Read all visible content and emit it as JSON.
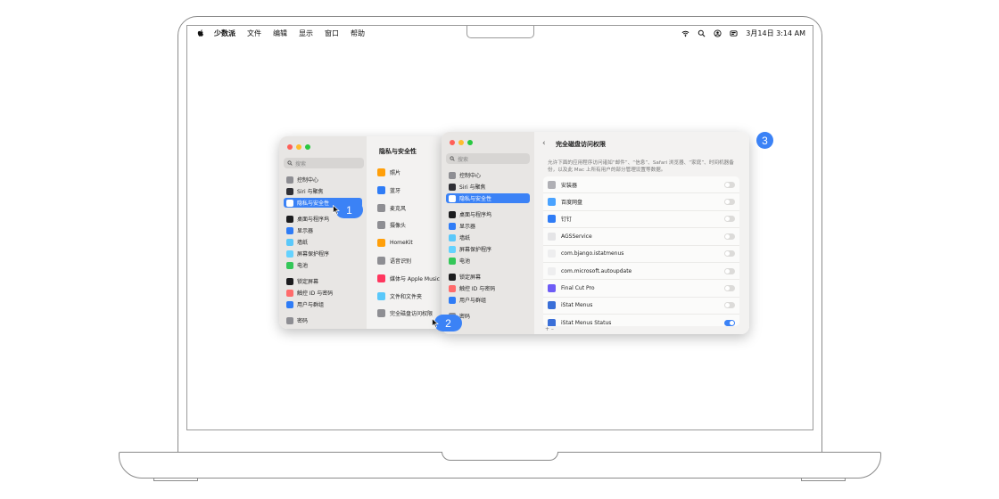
{
  "menubar": {
    "app_name": "少数派",
    "menus": [
      "文件",
      "编辑",
      "显示",
      "窗口",
      "帮助"
    ],
    "datetime": "3月14日  3:14 AM",
    "status_icons": [
      "wifi-icon",
      "search-icon",
      "user-icon",
      "control-center-icon"
    ]
  },
  "window1": {
    "search_placeholder": "搜索",
    "sidebar_items": [
      {
        "label": "控制中心",
        "color": "#8e8e93"
      },
      {
        "label": "Siri 与聚焦",
        "color": "#2f2f35"
      },
      {
        "label": "隐私与安全性",
        "color": "#3b82f6",
        "selected": true
      },
      {
        "label": "桌面与程序坞",
        "color": "#1c1c1e"
      },
      {
        "label": "显示器",
        "color": "#2f7cf6"
      },
      {
        "label": "墙纸",
        "color": "#5ac8fa"
      },
      {
        "label": "屏幕保护程序",
        "color": "#64d2ff"
      },
      {
        "label": "电池",
        "color": "#34c759"
      },
      {
        "label": "锁定屏幕",
        "color": "#1c1c1e"
      },
      {
        "label": "触控 ID 与密码",
        "color": "#ff6b6b"
      },
      {
        "label": "用户与群组",
        "color": "#2f7cf6"
      },
      {
        "label": "密码",
        "color": "#8e8e93"
      }
    ],
    "main_title": "隐私与安全性",
    "main_items": [
      {
        "label": "照片",
        "color": "#ff9f0a"
      },
      {
        "label": "蓝牙",
        "color": "#2f7cf6"
      },
      {
        "label": "麦克风",
        "color": "#8e8e93"
      },
      {
        "label": "摄像头",
        "color": "#8e8e93"
      },
      {
        "label": "HomeKit",
        "color": "#ff9f0a"
      },
      {
        "label": "语音识别",
        "color": "#8e8e93"
      },
      {
        "label": "媒体与 Apple Music",
        "color": "#ff375f"
      },
      {
        "label": "文件和文件夹",
        "color": "#5ac8fa"
      },
      {
        "label": "完全磁盘访问权限",
        "color": "#8e8e93"
      }
    ]
  },
  "window2": {
    "search_placeholder": "搜索",
    "sidebar_items": [
      {
        "label": "控制中心",
        "color": "#8e8e93"
      },
      {
        "label": "Siri 与聚焦",
        "color": "#2f2f35"
      },
      {
        "label": "隐私与安全性",
        "color": "#3b82f6",
        "selected": true
      },
      {
        "label": "桌面与程序坞",
        "color": "#1c1c1e"
      },
      {
        "label": "显示器",
        "color": "#2f7cf6"
      },
      {
        "label": "墙纸",
        "color": "#5ac8fa"
      },
      {
        "label": "屏幕保护程序",
        "color": "#64d2ff"
      },
      {
        "label": "电池",
        "color": "#34c759"
      },
      {
        "label": "锁定屏幕",
        "color": "#1c1c1e"
      },
      {
        "label": "触控 ID 与密码",
        "color": "#ff6b6b"
      },
      {
        "label": "用户与群组",
        "color": "#2f7cf6"
      },
      {
        "label": "密码",
        "color": "#8e8e93"
      }
    ],
    "detail_title": "完全磁盘访问权限",
    "description": "允许下面的应用程序访问诸如“邮件”、“信息”、Safari 浏览器、“家庭”、时间机器备份，以及此 Mac 上所有用户的部分管理设置等数据。",
    "apps": [
      {
        "name": "安装器",
        "color": "#b0b0b5",
        "on": false
      },
      {
        "name": "百度网盘",
        "color": "#4aa3ff",
        "on": false
      },
      {
        "name": "钉钉",
        "color": "#2f7cf6",
        "on": false
      },
      {
        "name": "AGSService",
        "color": "#e5e5e7",
        "on": false
      },
      {
        "name": "com.bjango.istatmenus",
        "color": "#eeeeef",
        "on": false
      },
      {
        "name": "com.microsoft.autoupdate",
        "color": "#eeeeef",
        "on": false
      },
      {
        "name": "Final Cut Pro",
        "color": "#6e5cf6",
        "on": false
      },
      {
        "name": "iStat Menus",
        "color": "#3a6fd8",
        "on": false
      },
      {
        "name": "iStat Menus Status",
        "color": "#3a6fd8",
        "on": true
      }
    ],
    "add_remove": "+  –"
  },
  "steps": [
    "1",
    "2",
    "3"
  ]
}
